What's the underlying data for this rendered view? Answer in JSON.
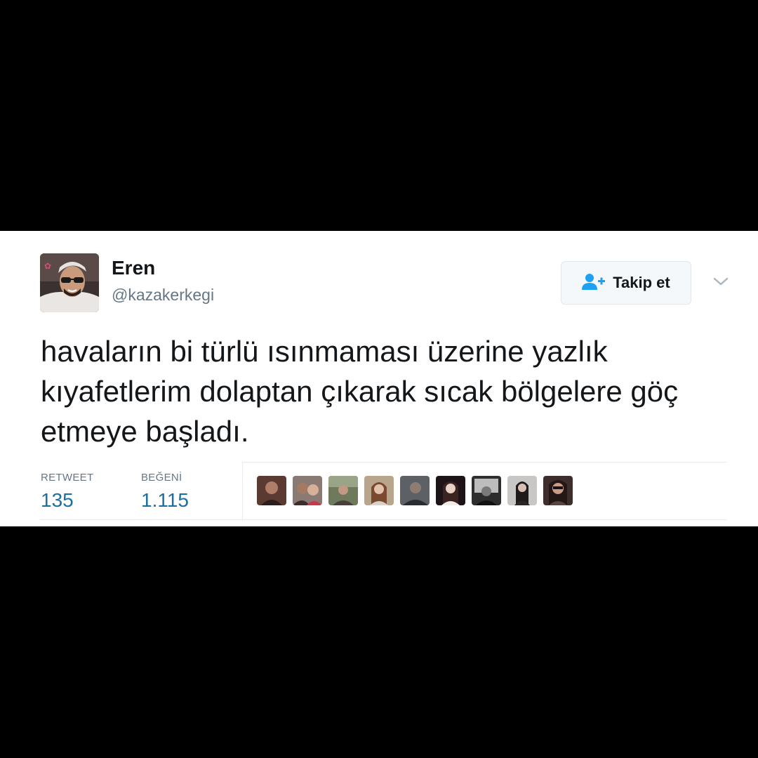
{
  "tweet": {
    "display_name": "Eren",
    "handle": "@kazakerkegi",
    "text": "havaların bi türlü ısınmaması üzerine yazlık kıyafetlerim dolaptan çıkarak sıcak bölgelere göç etmeye başladı."
  },
  "follow_button": {
    "label": "Takip et",
    "icon": "add-user-icon"
  },
  "menu": {
    "icon": "chevron-down-icon"
  },
  "stats": {
    "retweet_label": "RETWEET",
    "retweet_value": "135",
    "like_label": "BEĞENİ",
    "like_value": "1.115"
  },
  "likers_count_shown": 9,
  "colors": {
    "background": "#000000",
    "card": "#ffffff",
    "text": "#14171a",
    "secondary_text": "#657786",
    "stat_value": "#1c6fa0",
    "accent_blue": "#1da1f2",
    "divider": "#e6ecf0"
  }
}
